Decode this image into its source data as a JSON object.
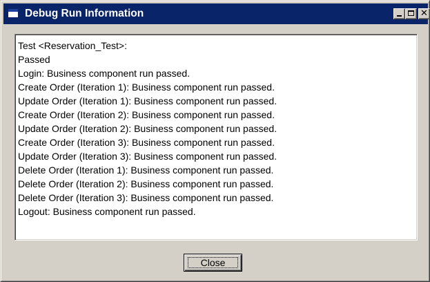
{
  "window": {
    "title": "Debug Run Information",
    "controls": {
      "minimize": "minimize-icon",
      "maximize": "maximize-icon",
      "close": "close-icon"
    }
  },
  "log": {
    "lines": [
      "Test <Reservation_Test>:",
      "Passed",
      "Login: Business component run passed.",
      "Create Order (Iteration 1): Business component run passed.",
      "Update Order (Iteration 1): Business component run passed.",
      "Create Order (Iteration 2): Business component run passed.",
      "Update Order (Iteration 2): Business component run passed.",
      "Create Order (Iteration 3): Business component run passed.",
      "Update Order (Iteration 3): Business component run passed.",
      "Delete Order (Iteration 1): Business component run passed.",
      "Delete Order (Iteration 2): Business component run passed.",
      "Delete Order (Iteration 3): Business component run passed.",
      "Logout: Business component run passed."
    ]
  },
  "buttons": {
    "close_label": "Close"
  },
  "colors": {
    "titlebar": "#0a246a",
    "face": "#d4d0c8",
    "text_background": "#ffffff"
  }
}
